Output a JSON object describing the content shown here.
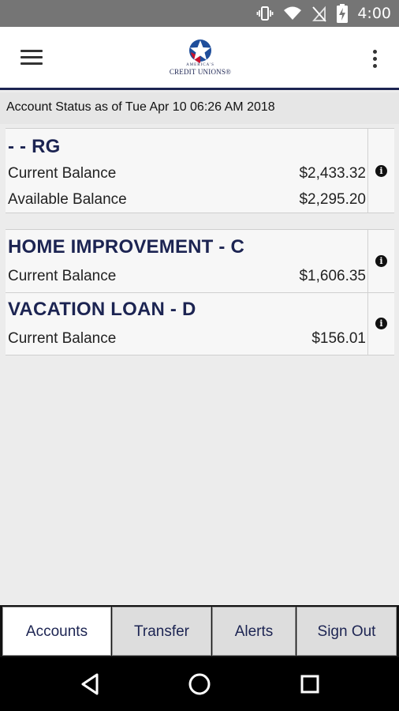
{
  "status_bar": {
    "time": "4:00",
    "icons": [
      "vibrate-icon",
      "wifi-icon",
      "no-sim-icon",
      "battery-charging-icon"
    ]
  },
  "app_bar": {
    "menu_icon": "hamburger-menu-icon",
    "logo": {
      "small_text": "AMERICA'S",
      "text": "CREDIT UNIONS®"
    },
    "overflow_icon": "more-vert-icon"
  },
  "account_status": {
    "label": "Account Status as of Tue Apr 10 06:26 AM 2018"
  },
  "accounts": [
    {
      "name": "- - RG",
      "rows": [
        {
          "label": "Current Balance",
          "value": "$2,433.32"
        },
        {
          "label": "Available Balance",
          "value": "$2,295.20"
        }
      ]
    },
    {
      "name": "HOME IMPROVEMENT - C",
      "rows": [
        {
          "label": "Current Balance",
          "value": "$1,606.35"
        }
      ]
    },
    {
      "name": "VACATION LOAN - D",
      "rows": [
        {
          "label": "Current Balance",
          "value": "$156.01"
        }
      ]
    }
  ],
  "info_icon": "i",
  "tabs": [
    {
      "label": "Accounts",
      "active": true
    },
    {
      "label": "Transfer",
      "active": false
    },
    {
      "label": "Alerts",
      "active": false
    },
    {
      "label": "Sign Out",
      "active": false
    }
  ],
  "nav": {
    "back": "back-icon",
    "home": "home-icon",
    "recents": "recents-icon"
  },
  "colors": {
    "brand_navy": "#1c2452",
    "status_bar": "#757575",
    "logo_red": "#c8102e",
    "logo_blue": "#1f4e9b"
  }
}
